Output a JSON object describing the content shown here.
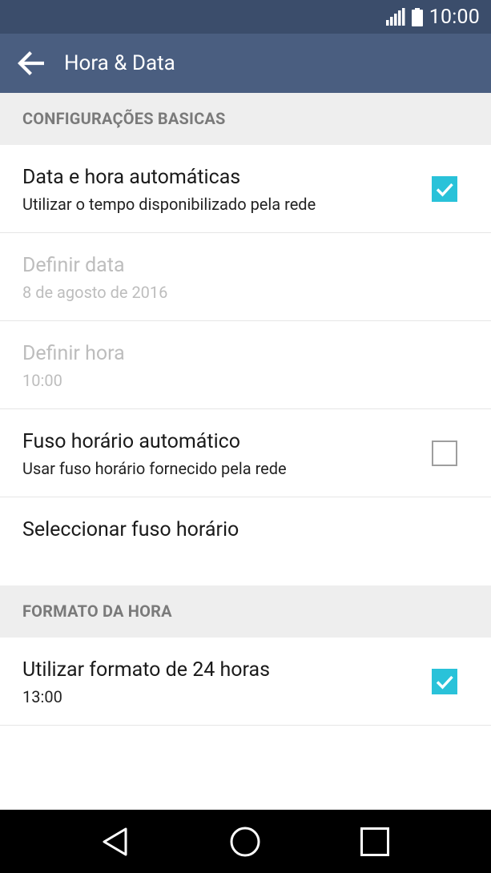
{
  "status_bar": {
    "time": "10:00"
  },
  "app_bar": {
    "title": "Hora & Data"
  },
  "sections": {
    "basic": {
      "header": "CONFIGURAÇÕES BASICAS",
      "auto_datetime": {
        "title": "Data e hora automáticas",
        "subtitle": "Utilizar o tempo disponibilizado pela rede",
        "checked": true
      },
      "set_date": {
        "title": "Definir data",
        "subtitle": "8 de agosto de 2016",
        "enabled": false
      },
      "set_time": {
        "title": "Definir hora",
        "subtitle": "10:00",
        "enabled": false
      },
      "auto_timezone": {
        "title": "Fuso horário automático",
        "subtitle": "Usar fuso horário fornecido pela rede",
        "checked": false
      },
      "select_timezone": {
        "title": "Seleccionar fuso horário"
      }
    },
    "time_format": {
      "header": "FORMATO DA HORA",
      "use_24h": {
        "title": "Utilizar formato de 24 horas",
        "subtitle": "13:00",
        "checked": true
      }
    }
  },
  "colors": {
    "status_bar": "#3b4d6b",
    "app_bar": "#4a5e80",
    "checkbox_accent": "#29c2d9",
    "section_header_bg": "#eeeeee",
    "disabled_text": "#bdbdbd"
  },
  "icons": {
    "signal": "signal-icon",
    "battery": "battery-icon",
    "back": "arrow-back-icon",
    "nav_back": "triangle-back-icon",
    "nav_home": "circle-home-icon",
    "nav_recents": "square-recents-icon"
  }
}
